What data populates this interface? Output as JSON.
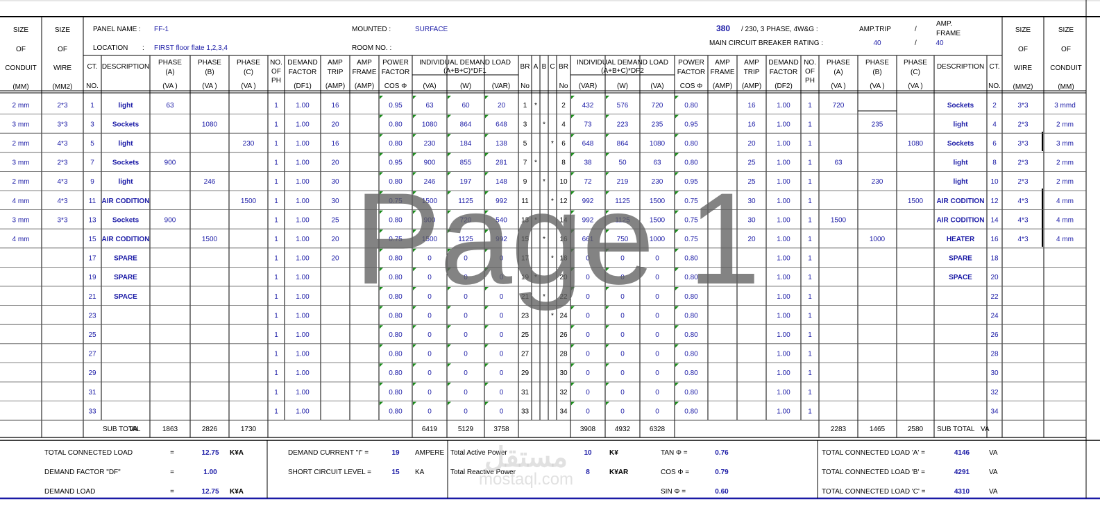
{
  "header": {
    "left_cols": {
      "conduit": [
        "SIZE",
        "OF",
        "CONDUIT",
        "(MM)"
      ],
      "wire": [
        "SIZE",
        "OF",
        "WIRE",
        "(MM2)"
      ]
    },
    "right_cols": {
      "wire": [
        "SIZE",
        "OF",
        "WIRE",
        "(MM2)"
      ],
      "conduit": [
        "SIZE",
        "OF",
        "CONDUIT",
        "(MM)"
      ]
    },
    "panel_name_label": "PANEL NAME :",
    "panel_name": "FF-1",
    "location_label": "LOCATION",
    "location_colon": ":",
    "location": "FIRST floor flate 1,2,3,4",
    "mounted_label": "MOUNTED   :",
    "mounted": "SURFACE",
    "room_no_label": "ROOM NO. :",
    "voltage": "380",
    "voltage_rest": "/ 230, 3 PHASE, 4W&G :",
    "amp_trip_label": "AMP.TRIP",
    "slash": "/",
    "amp_frame_label": [
      "AMP.",
      "FRAME"
    ],
    "main_cb_label": "MAIN CIRCUIT BREAKER RATING :",
    "main_cb_trip": "40",
    "main_cb_frame": "40"
  },
  "colheads": {
    "ct": [
      "CT.",
      "NO."
    ],
    "description": "DESCRIPTION",
    "phase_a": [
      "PHASE",
      "(A)",
      "(VA )"
    ],
    "phase_b": [
      "PHASE",
      "(B)",
      "(VA )"
    ],
    "phase_c": [
      "PHASE",
      "(C)",
      "(VA )"
    ],
    "no_of_ph": [
      "NO.",
      "OF",
      "PH"
    ],
    "demand_factor1": [
      "DEMAND",
      "FACTOR",
      "(DF1)"
    ],
    "demand_factor2": [
      "DEMAND",
      "FACTOR",
      "(DF2)"
    ],
    "amp_trip": [
      "AMP",
      "TRIP",
      "(AMP)"
    ],
    "amp_frame": [
      "AMP",
      "FRAME",
      "(AMP)"
    ],
    "power_factor": [
      "POWER",
      "FACTOR",
      "COS Φ"
    ],
    "idl1": [
      "INDIVIDUAL DEMAND LOAD",
      "(A+B+C)*DF1"
    ],
    "idl2": [
      "INDIVIDUAL DEMAND LOAD",
      "(A+B+C)*DF2"
    ],
    "va": "(VA)",
    "w": "(W)",
    "var": "(VAR)",
    "br": [
      "BR",
      "No"
    ],
    "a": "A",
    "b": "B",
    "c": "C"
  },
  "rows": [
    {
      "lcond": "2 mm",
      "lwire": "2*3",
      "lct": "1",
      "ldesc": "light",
      "lpa": "63",
      "lpb": "",
      "lpc": "",
      "lnph": "1",
      "ldf": "1.00",
      "ltrip": "16",
      "lframe": "",
      "lpf": "0.95",
      "l_va": "63",
      "l_w": "60",
      "l_var": "20",
      "lbr": "1",
      "ma": "*",
      "mb": "",
      "mc": "",
      "rbr": "2",
      "r_var": "432",
      "r_w": "576",
      "r_va": "720",
      "rpf": "0.80",
      "rframe": "",
      "rtrip": "16",
      "rdf": "1.00",
      "rnph": "1",
      "rpa": "720",
      "rpb": "",
      "rpc": "",
      "rdesc": "Sockets",
      "rct": "2",
      "rwire": "3*3",
      "rcond": "3 mmd"
    },
    {
      "lcond": "3 mm",
      "lwire": "3*3",
      "lct": "3",
      "ldesc": "Sockets",
      "lpa": "",
      "lpb": "1080",
      "lpc": "",
      "lnph": "1",
      "ldf": "1.00",
      "ltrip": "20",
      "lframe": "",
      "lpf": "0.80",
      "l_va": "1080",
      "l_w": "864",
      "l_var": "648",
      "lbr": "3",
      "ma": "",
      "mb": "*",
      "mc": "",
      "rbr": "4",
      "r_var": "73",
      "r_w": "223",
      "r_va": "235",
      "rpf": "0.95",
      "rframe": "",
      "rtrip": "16",
      "rdf": "1.00",
      "rnph": "1",
      "rpa": "",
      "rpb": "235",
      "rpc": "",
      "rdesc": "light",
      "rct": "4",
      "rwire": "2*3",
      "rcond": "2 mm"
    },
    {
      "lcond": "2 mm",
      "lwire": "4*3",
      "lct": "5",
      "ldesc": "light",
      "lpa": "",
      "lpb": "",
      "lpc": "230",
      "lnph": "1",
      "ldf": "1.00",
      "ltrip": "16",
      "lframe": "",
      "lpf": "0.80",
      "l_va": "230",
      "l_w": "184",
      "l_var": "138",
      "lbr": "5",
      "ma": "",
      "mb": "",
      "mc": "*",
      "rbr": "6",
      "r_var": "648",
      "r_w": "864",
      "r_va": "1080",
      "rpf": "0.80",
      "rframe": "",
      "rtrip": "20",
      "rdf": "1.00",
      "rnph": "1",
      "rpa": "",
      "rpb": "",
      "rpc": "1080",
      "rdesc": "Sockets",
      "rct": "6",
      "rwire": "3*3",
      "rcond": "3 mm"
    },
    {
      "lcond": "3 mm",
      "lwire": "2*3",
      "lct": "7",
      "ldesc": "Sockets",
      "lpa": "900",
      "lpb": "",
      "lpc": "",
      "lnph": "1",
      "ldf": "1.00",
      "ltrip": "20",
      "lframe": "",
      "lpf": "0.95",
      "l_va": "900",
      "l_w": "855",
      "l_var": "281",
      "lbr": "7",
      "ma": "*",
      "mb": "",
      "mc": "",
      "rbr": "8",
      "r_var": "38",
      "r_w": "50",
      "r_va": "63",
      "rpf": "0.80",
      "rframe": "",
      "rtrip": "25",
      "rdf": "1.00",
      "rnph": "1",
      "rpa": "63",
      "rpb": "",
      "rpc": "",
      "rdesc": "light",
      "rct": "8",
      "rwire": "2*3",
      "rcond": "2 mm"
    },
    {
      "lcond": "2 mm",
      "lwire": "4*3",
      "lct": "9",
      "ldesc": "light",
      "lpa": "",
      "lpb": "246",
      "lpc": "",
      "lnph": "1",
      "ldf": "1.00",
      "ltrip": "30",
      "lframe": "",
      "lpf": "0.80",
      "l_va": "246",
      "l_w": "197",
      "l_var": "148",
      "lbr": "9",
      "ma": "",
      "mb": "*",
      "mc": "",
      "rbr": "10",
      "r_var": "72",
      "r_w": "219",
      "r_va": "230",
      "rpf": "0.95",
      "rframe": "",
      "rtrip": "25",
      "rdf": "1.00",
      "rnph": "1",
      "rpa": "",
      "rpb": "230",
      "rpc": "",
      "rdesc": "light",
      "rct": "10",
      "rwire": "2*3",
      "rcond": "2 mm"
    },
    {
      "lcond": "4 mm",
      "lwire": "4*3",
      "lct": "11",
      "ldesc": "AIR CODITION",
      "lpa": "",
      "lpb": "",
      "lpc": "1500",
      "lnph": "1",
      "ldf": "1.00",
      "ltrip": "30",
      "lframe": "",
      "lpf": "0.75",
      "l_va": "1500",
      "l_w": "1125",
      "l_var": "992",
      "lbr": "11",
      "ma": "",
      "mb": "",
      "mc": "*",
      "rbr": "12",
      "r_var": "992",
      "r_w": "1125",
      "r_va": "1500",
      "rpf": "0.75",
      "rframe": "",
      "rtrip": "30",
      "rdf": "1.00",
      "rnph": "1",
      "rpa": "",
      "rpb": "",
      "rpc": "1500",
      "rdesc": "AIR CODITION",
      "rct": "12",
      "rwire": "4*3",
      "rcond": "4 mm"
    },
    {
      "lcond": "3 mm",
      "lwire": "3*3",
      "lct": "13",
      "ldesc": "Sockets",
      "lpa": "900",
      "lpb": "",
      "lpc": "",
      "lnph": "1",
      "ldf": "1.00",
      "ltrip": "25",
      "lframe": "",
      "lpf": "0.80",
      "l_va": "900",
      "l_w": "720",
      "l_var": "540",
      "lbr": "13",
      "ma": "*",
      "mb": "",
      "mc": "",
      "rbr": "14",
      "r_var": "992",
      "r_w": "1125",
      "r_va": "1500",
      "rpf": "0.75",
      "rframe": "",
      "rtrip": "30",
      "rdf": "1.00",
      "rnph": "1",
      "rpa": "1500",
      "rpb": "",
      "rpc": "",
      "rdesc": "AIR CODITION",
      "rct": "14",
      "rwire": "4*3",
      "rcond": "4 mm"
    },
    {
      "lcond": "4 mm",
      "lwire": "",
      "lct": "15",
      "ldesc": "AIR CODITION",
      "lpa": "",
      "lpb": "1500",
      "lpc": "",
      "lnph": "1",
      "ldf": "1.00",
      "ltrip": "20",
      "lframe": "",
      "lpf": "0.75",
      "l_va": "1500",
      "l_w": "1125",
      "l_var": "992",
      "lbr": "15",
      "ma": "",
      "mb": "*",
      "mc": "",
      "rbr": "16",
      "r_var": "661",
      "r_w": "750",
      "r_va": "1000",
      "rpf": "0.75",
      "rframe": "",
      "rtrip": "20",
      "rdf": "1.00",
      "rnph": "1",
      "rpa": "",
      "rpb": "1000",
      "rpc": "",
      "rdesc": "HEATER",
      "rct": "16",
      "rwire": "4*3",
      "rcond": "4 mm"
    },
    {
      "lcond": "",
      "lwire": "",
      "lct": "17",
      "ldesc": "SPARE",
      "lpa": "",
      "lpb": "",
      "lpc": "",
      "lnph": "1",
      "ldf": "1.00",
      "ltrip": "20",
      "lframe": "",
      "lpf": "0.80",
      "l_va": "0",
      "l_w": "0",
      "l_var": "0",
      "lbr": "17",
      "ma": "",
      "mb": "",
      "mc": "*",
      "rbr": "18",
      "r_var": "0",
      "r_w": "0",
      "r_va": "0",
      "rpf": "0.80",
      "rframe": "",
      "rtrip": "",
      "rdf": "1.00",
      "rnph": "1",
      "rpa": "",
      "rpb": "",
      "rpc": "",
      "rdesc": "SPARE",
      "rct": "18",
      "rwire": "",
      "rcond": ""
    },
    {
      "lcond": "",
      "lwire": "",
      "lct": "19",
      "ldesc": "SPARE",
      "lpa": "",
      "lpb": "",
      "lpc": "",
      "lnph": "1",
      "ldf": "1.00",
      "ltrip": "",
      "lframe": "",
      "lpf": "0.80",
      "l_va": "0",
      "l_w": "0",
      "l_var": "0",
      "lbr": "19",
      "ma": "*",
      "mb": "",
      "mc": "",
      "rbr": "20",
      "r_var": "0",
      "r_w": "0",
      "r_va": "0",
      "rpf": "0.80",
      "rframe": "",
      "rtrip": "",
      "rdf": "1.00",
      "rnph": "1",
      "rpa": "",
      "rpb": "",
      "rpc": "",
      "rdesc": "SPACE",
      "rct": "20",
      "rwire": "",
      "rcond": ""
    },
    {
      "lcond": "",
      "lwire": "",
      "lct": "21",
      "ldesc": "SPACE",
      "lpa": "",
      "lpb": "",
      "lpc": "",
      "lnph": "1",
      "ldf": "1.00",
      "ltrip": "",
      "lframe": "",
      "lpf": "0.80",
      "l_va": "0",
      "l_w": "0",
      "l_var": "0",
      "lbr": "21",
      "ma": "",
      "mb": "*",
      "mc": "",
      "rbr": "22",
      "r_var": "0",
      "r_w": "0",
      "r_va": "0",
      "rpf": "0.80",
      "rframe": "",
      "rtrip": "",
      "rdf": "1.00",
      "rnph": "1",
      "rpa": "",
      "rpb": "",
      "rpc": "",
      "rdesc": "",
      "rct": "22",
      "rwire": "",
      "rcond": ""
    },
    {
      "lcond": "",
      "lwire": "",
      "lct": "23",
      "ldesc": "",
      "lpa": "",
      "lpb": "",
      "lpc": "",
      "lnph": "1",
      "ldf": "1.00",
      "ltrip": "",
      "lframe": "",
      "lpf": "0.80",
      "l_va": "0",
      "l_w": "0",
      "l_var": "0",
      "lbr": "23",
      "ma": "",
      "mb": "",
      "mc": "*",
      "rbr": "24",
      "r_var": "0",
      "r_w": "0",
      "r_va": "0",
      "rpf": "0.80",
      "rframe": "",
      "rtrip": "",
      "rdf": "1.00",
      "rnph": "1",
      "rpa": "",
      "rpb": "",
      "rpc": "",
      "rdesc": "",
      "rct": "24",
      "rwire": "",
      "rcond": ""
    },
    {
      "lcond": "",
      "lwire": "",
      "lct": "25",
      "ldesc": "",
      "lpa": "",
      "lpb": "",
      "lpc": "",
      "lnph": "1",
      "ldf": "1.00",
      "ltrip": "",
      "lframe": "",
      "lpf": "0.80",
      "l_va": "0",
      "l_w": "0",
      "l_var": "0",
      "lbr": "25",
      "ma": "",
      "mb": "",
      "mc": "",
      "rbr": "26",
      "r_var": "0",
      "r_w": "0",
      "r_va": "0",
      "rpf": "0.80",
      "rframe": "",
      "rtrip": "",
      "rdf": "1.00",
      "rnph": "1",
      "rpa": "",
      "rpb": "",
      "rpc": "",
      "rdesc": "",
      "rct": "26",
      "rwire": "",
      "rcond": ""
    },
    {
      "lcond": "",
      "lwire": "",
      "lct": "27",
      "ldesc": "",
      "lpa": "",
      "lpb": "",
      "lpc": "",
      "lnph": "1",
      "ldf": "1.00",
      "ltrip": "",
      "lframe": "",
      "lpf": "0.80",
      "l_va": "0",
      "l_w": "0",
      "l_var": "0",
      "lbr": "27",
      "ma": "",
      "mb": "",
      "mc": "",
      "rbr": "28",
      "r_var": "0",
      "r_w": "0",
      "r_va": "0",
      "rpf": "0.80",
      "rframe": "",
      "rtrip": "",
      "rdf": "1.00",
      "rnph": "1",
      "rpa": "",
      "rpb": "",
      "rpc": "",
      "rdesc": "",
      "rct": "28",
      "rwire": "",
      "rcond": ""
    },
    {
      "lcond": "",
      "lwire": "",
      "lct": "29",
      "ldesc": "",
      "lpa": "",
      "lpb": "",
      "lpc": "",
      "lnph": "1",
      "ldf": "1.00",
      "ltrip": "",
      "lframe": "",
      "lpf": "0.80",
      "l_va": "0",
      "l_w": "0",
      "l_var": "0",
      "lbr": "29",
      "ma": "",
      "mb": "",
      "mc": "",
      "rbr": "30",
      "r_var": "0",
      "r_w": "0",
      "r_va": "0",
      "rpf": "0.80",
      "rframe": "",
      "rtrip": "",
      "rdf": "1.00",
      "rnph": "1",
      "rpa": "",
      "rpb": "",
      "rpc": "",
      "rdesc": "",
      "rct": "30",
      "rwire": "",
      "rcond": ""
    },
    {
      "lcond": "",
      "lwire": "",
      "lct": "31",
      "ldesc": "",
      "lpa": "",
      "lpb": "",
      "lpc": "",
      "lnph": "1",
      "ldf": "1.00",
      "ltrip": "",
      "lframe": "",
      "lpf": "0.80",
      "l_va": "0",
      "l_w": "0",
      "l_var": "0",
      "lbr": "31",
      "ma": "",
      "mb": "",
      "mc": "",
      "rbr": "32",
      "r_var": "0",
      "r_w": "0",
      "r_va": "0",
      "rpf": "0.80",
      "rframe": "",
      "rtrip": "",
      "rdf": "1.00",
      "rnph": "1",
      "rpa": "",
      "rpb": "",
      "rpc": "",
      "rdesc": "",
      "rct": "32",
      "rwire": "",
      "rcond": ""
    },
    {
      "lcond": "",
      "lwire": "",
      "lct": "33",
      "ldesc": "",
      "lpa": "",
      "lpb": "",
      "lpc": "",
      "lnph": "1",
      "ldf": "1.00",
      "ltrip": "",
      "lframe": "",
      "lpf": "0.80",
      "l_va": "0",
      "l_w": "0",
      "l_var": "0",
      "lbr": "33",
      "ma": "",
      "mb": "",
      "mc": "",
      "rbr": "34",
      "r_var": "0",
      "r_w": "0",
      "r_va": "0",
      "rpf": "0.80",
      "rframe": "",
      "rtrip": "",
      "rdf": "1.00",
      "rnph": "1",
      "rpa": "",
      "rpb": "",
      "rpc": "",
      "rdesc": "",
      "rct": "34",
      "rwire": "",
      "rcond": ""
    }
  ],
  "subtotal": {
    "label_left": "SUB TOTAL",
    "unit_left": "VA",
    "pa": "1863",
    "pb": "2826",
    "pc": "1730",
    "l_va": "6419",
    "l_w": "5129",
    "l_var": "3758",
    "r_var": "3908",
    "r_w": "4932",
    "r_va": "6328",
    "rpa": "2283",
    "rpb": "1465",
    "rpc": "2580",
    "label_right": "SUB TOTAL",
    "unit_right": "VA"
  },
  "summary": {
    "total_connected_load_label": "TOTAL CONNECTED LOAD",
    "eq": "=",
    "total_connected_load": "12.75",
    "kva": "K¥A",
    "demand_factor_label": "DEMAND FACTOR   \"DF\"",
    "demand_factor": "1.00",
    "demand_load_label": "DEMAND LOAD",
    "demand_load": "12.75",
    "demand_current_label": "DEMAND CURRENT  \"I\"   =",
    "demand_current": "19",
    "ampere": "AMPERE",
    "short_circuit_label": "SHORT CIRCUIT LEVEL    =",
    "short_circuit": "15",
    "ka": "KA",
    "total_active_power_label": "Total Active Power",
    "total_active_power": "10",
    "kw": "K¥",
    "total_reactive_power_label": "Total Reactive Power",
    "total_reactive_power": "8",
    "kvar": "K¥AR",
    "tan_label": "TAN Φ =",
    "tan": "0.76",
    "cos_label": "COS Φ =",
    "cos": "0.79",
    "sin_label": "SIN Φ =",
    "sin": "0.60",
    "tcl_a_label": "TOTAL CONNECTED LOAD 'A'   =",
    "tcl_a": "4146",
    "tcl_b_label": "TOTAL CONNECTED LOAD 'B'   =",
    "tcl_b": "4291",
    "tcl_c_label": "TOTAL CONNECTED LOAD 'C'   =",
    "tcl_c": "4310",
    "va": "VA"
  },
  "watermark": {
    "page": "Page 1",
    "site_ar": "مستقل",
    "site": "mostaql.com"
  }
}
